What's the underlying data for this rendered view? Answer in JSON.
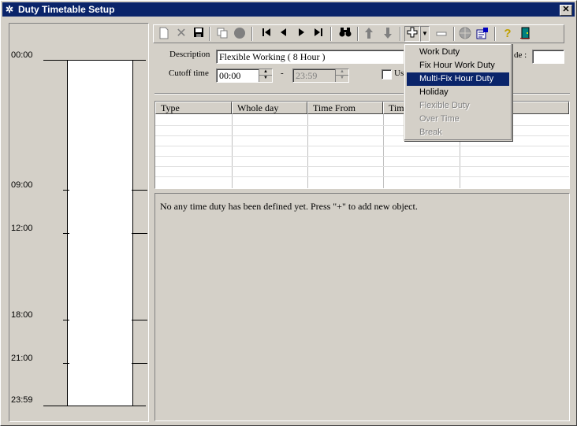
{
  "window": {
    "title": "Duty Timetable Setup",
    "close_label": "✕"
  },
  "timeline": {
    "labels": [
      "00:00",
      "09:00",
      "12:00",
      "18:00",
      "21:00",
      "23:59"
    ]
  },
  "toolbar": {
    "new_icon": "new-document-icon",
    "delete_icon": "delete-icon",
    "save_icon": "save-icon",
    "copy_icon": "copy-icon",
    "stop_icon": "circle-icon",
    "first_icon": "first-record-icon",
    "prev_icon": "prev-record-icon",
    "next_icon": "next-record-icon",
    "last_icon": "last-record-icon",
    "find_icon": "binoculars-icon",
    "up_icon": "arrow-up-icon",
    "down_icon": "arrow-down-icon",
    "add_icon": "plus-icon",
    "remove_icon": "minus-icon",
    "globe_icon": "globe-icon",
    "props_icon": "properties-icon",
    "help_icon": "help-icon",
    "exit_icon": "exit-door-icon"
  },
  "form": {
    "description_label": "Description",
    "description_value": "Flexible Working ( 8 Hour )",
    "cutoff_label": "Cutoff time",
    "cutoff_from": "00:00",
    "cutoff_dash": "-",
    "cutoff_to": "23:59",
    "use_label": "Us",
    "code_label": "de :",
    "code_value": ""
  },
  "grid": {
    "columns": [
      "Type",
      "Whole day",
      "Time From",
      "Time",
      ""
    ]
  },
  "message": "No any time duty has been defined yet. Press \"+\" to add new object.",
  "menu": {
    "items": [
      {
        "label": "Work Duty",
        "state": "normal"
      },
      {
        "label": "Fix Hour Work Duty",
        "state": "normal"
      },
      {
        "label": "Multi-Fix Hour Duty",
        "state": "selected"
      },
      {
        "label": "Holiday",
        "state": "normal"
      },
      {
        "label": "Flexible Duty",
        "state": "disabled"
      },
      {
        "label": "Over Time",
        "state": "disabled"
      },
      {
        "label": "Break",
        "state": "disabled"
      }
    ]
  },
  "colors": {
    "titlebar": "#0a246a",
    "face": "#d4d0c8",
    "selection": "#0a246a"
  }
}
